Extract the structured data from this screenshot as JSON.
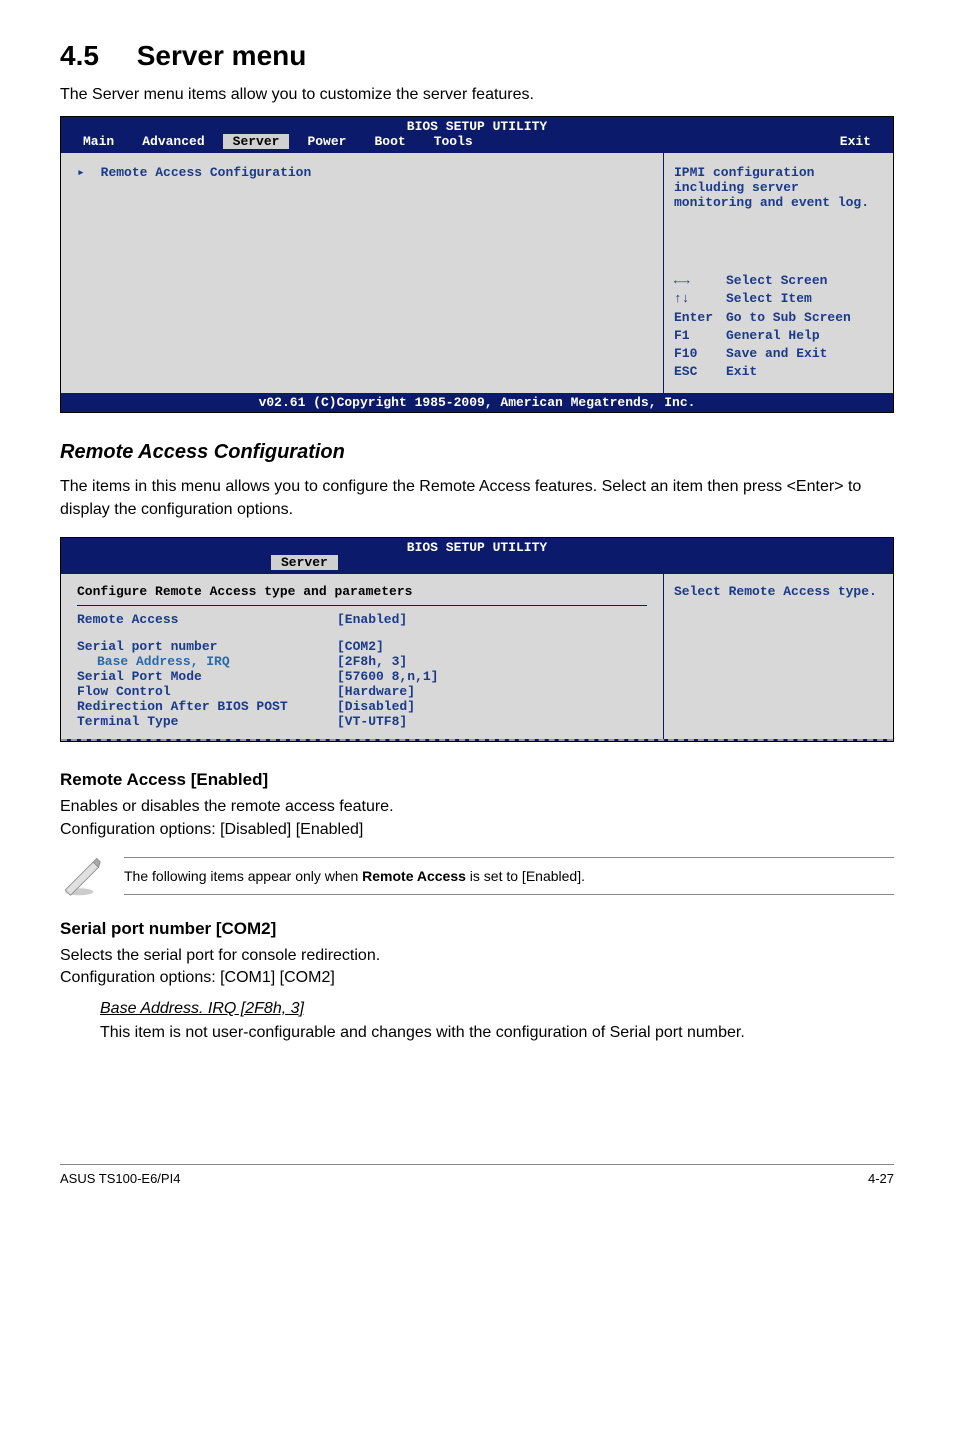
{
  "section": {
    "number": "4.5",
    "title": "Server menu"
  },
  "intro": "The Server menu items allow you to customize the server features.",
  "bios1": {
    "title": "BIOS SETUP UTILITY",
    "tabs": [
      "Main",
      "Advanced",
      "Server",
      "Power",
      "Boot",
      "Tools",
      "Exit"
    ],
    "active_tab": "Server",
    "item": "Remote Access Configuration",
    "help_text": "IPMI configuration including server monitoring and event log.",
    "keys": [
      {
        "k": "←→",
        "v": "Select Screen"
      },
      {
        "k": "↑↓",
        "v": "Select Item"
      },
      {
        "k": "Enter",
        "v": "Go to Sub Screen"
      },
      {
        "k": "F1",
        "v": "General Help"
      },
      {
        "k": "F10",
        "v": "Save and Exit"
      },
      {
        "k": "ESC",
        "v": "Exit"
      }
    ],
    "footer": "v02.61 (C)Copyright 1985-2009, American Megatrends, Inc."
  },
  "sub1": {
    "heading": "Remote Access Configuration",
    "desc": "The items in this menu allows you to configure the Remote Access features. Select an item then press <Enter> to display the configuration options."
  },
  "bios2": {
    "title": "BIOS SETUP UTILITY",
    "tab": "Server",
    "header_line": "Configure Remote Access type and parameters",
    "help_text": "Select Remote Access type.",
    "rows": [
      {
        "label": "Remote Access",
        "value": "[Enabled]"
      },
      {
        "label": "Serial port number",
        "value": "[COM2]"
      },
      {
        "label": "Base Address, IRQ",
        "value": "[2F8h, 3]",
        "indent": true
      },
      {
        "label": "Serial Port Mode",
        "value": "[57600 8,n,1]"
      },
      {
        "label": "Flow Control",
        "value": "[Hardware]"
      },
      {
        "label": "Redirection After BIOS POST",
        "value": "[Disabled]"
      },
      {
        "label": "Terminal Type",
        "value": "[VT-UTF8]"
      }
    ]
  },
  "remote_access": {
    "heading": "Remote Access [Enabled]",
    "line1": "Enables or disables the remote access feature.",
    "line2": "Configuration options: [Disabled] [Enabled]"
  },
  "note": {
    "text_pre": "The following items appear only when ",
    "bold": "Remote Access",
    "text_post": " is set to [Enabled]."
  },
  "serial_port": {
    "heading": "Serial port number [COM2]",
    "line1": "Selects the serial port for console redirection.",
    "line2": "Configuration options: [COM1] [COM2]"
  },
  "base_addr": {
    "heading": "Base Address. IRQ [2F8h, 3]",
    "body": "This item is not user-configurable and changes with the configuration of Serial port number."
  },
  "footer": {
    "left": "ASUS TS100-E6/PI4",
    "right": "4-27"
  }
}
